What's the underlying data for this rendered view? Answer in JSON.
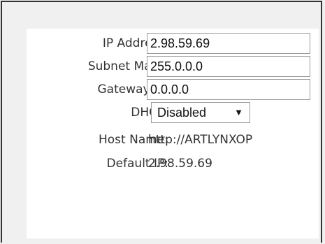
{
  "form": {
    "ip_address": {
      "label": "IP Address:",
      "value": "2.98.59.69"
    },
    "subnet_mask": {
      "label": "Subnet Mask:",
      "value": "255.0.0.0"
    },
    "gateway_ip": {
      "label": "Gateway IP:",
      "value": "0.0.0.0"
    },
    "dhcp": {
      "label": "DHCP:",
      "selected": "Disabled",
      "arrow_icon": "triangle-down"
    },
    "host_name": {
      "label": "Host Name:",
      "value": "http://ARTLYNXOP"
    },
    "default_ip": {
      "label": "Default IP:",
      "value": "2.98.59.69"
    }
  },
  "colors": {
    "frame_border": "#333333",
    "outer_background": "#f0f0f0",
    "panel_background": "#ffffff",
    "field_border": "#9a9a9a",
    "label_text": "#333333"
  }
}
